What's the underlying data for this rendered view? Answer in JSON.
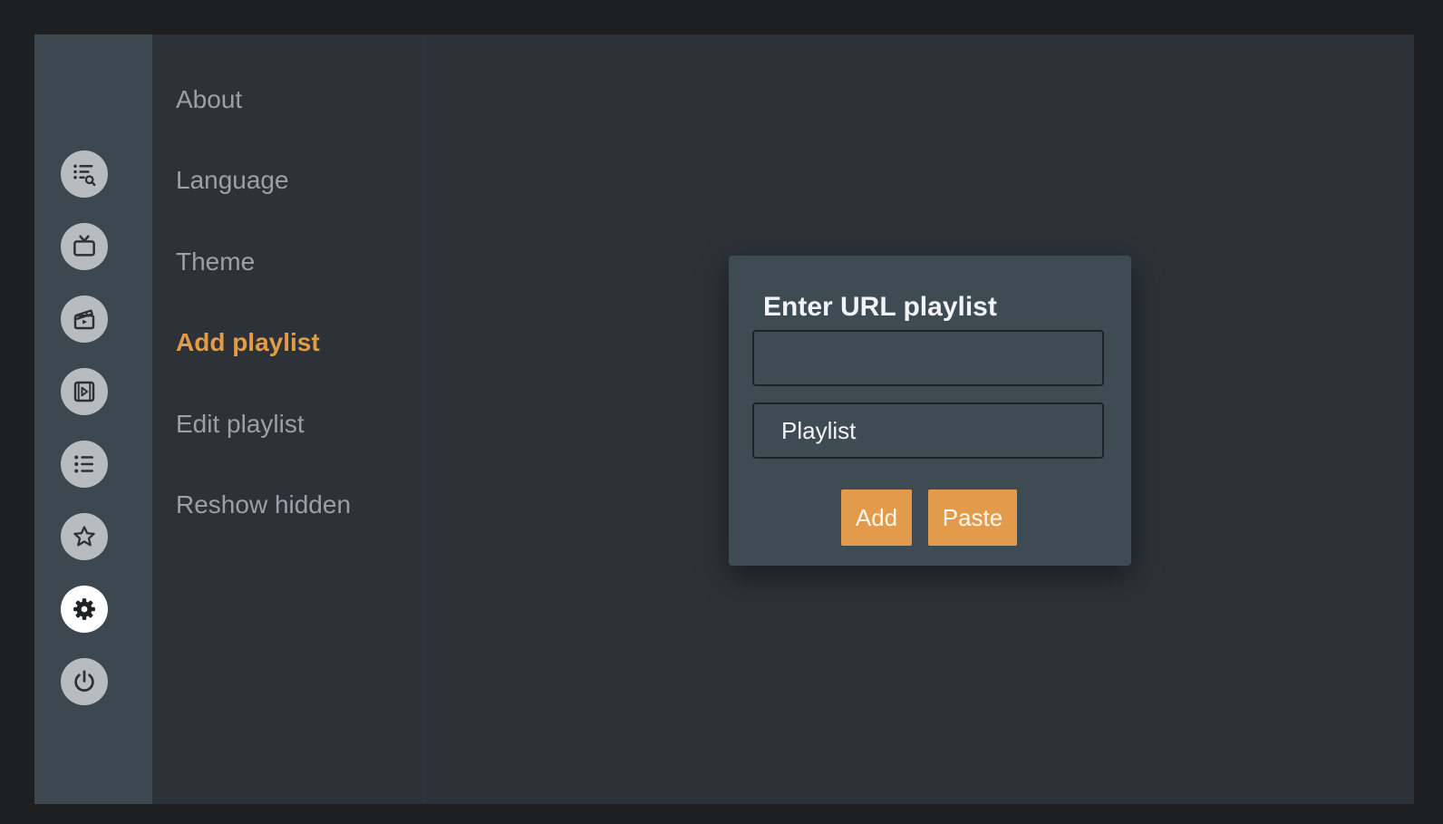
{
  "sidebar": {
    "icons": [
      {
        "name": "playlist-search-icon",
        "active": false
      },
      {
        "name": "tv-icon",
        "active": false
      },
      {
        "name": "movie-clapper-icon",
        "active": false
      },
      {
        "name": "video-film-icon",
        "active": false
      },
      {
        "name": "list-icon",
        "active": false
      },
      {
        "name": "star-icon",
        "active": false
      },
      {
        "name": "gear-icon",
        "active": true
      },
      {
        "name": "power-icon",
        "active": false
      }
    ]
  },
  "settings_menu": {
    "items": [
      {
        "label": "About",
        "active": false
      },
      {
        "label": "Language",
        "active": false
      },
      {
        "label": "Theme",
        "active": false
      },
      {
        "label": "Add playlist",
        "active": true
      },
      {
        "label": "Edit playlist",
        "active": false
      },
      {
        "label": "Reshow hidden",
        "active": false
      }
    ]
  },
  "dialog": {
    "title": "Enter URL playlist",
    "url_field": {
      "value": "",
      "placeholder": ""
    },
    "name_field": {
      "value": "Playlist",
      "placeholder": ""
    },
    "add_label": "Add",
    "paste_label": "Paste"
  },
  "colors": {
    "accent": "#e39b45",
    "rail_background": "#3c4750",
    "panel_background": "#2d3239",
    "dialog_background": "#3e4b53"
  }
}
